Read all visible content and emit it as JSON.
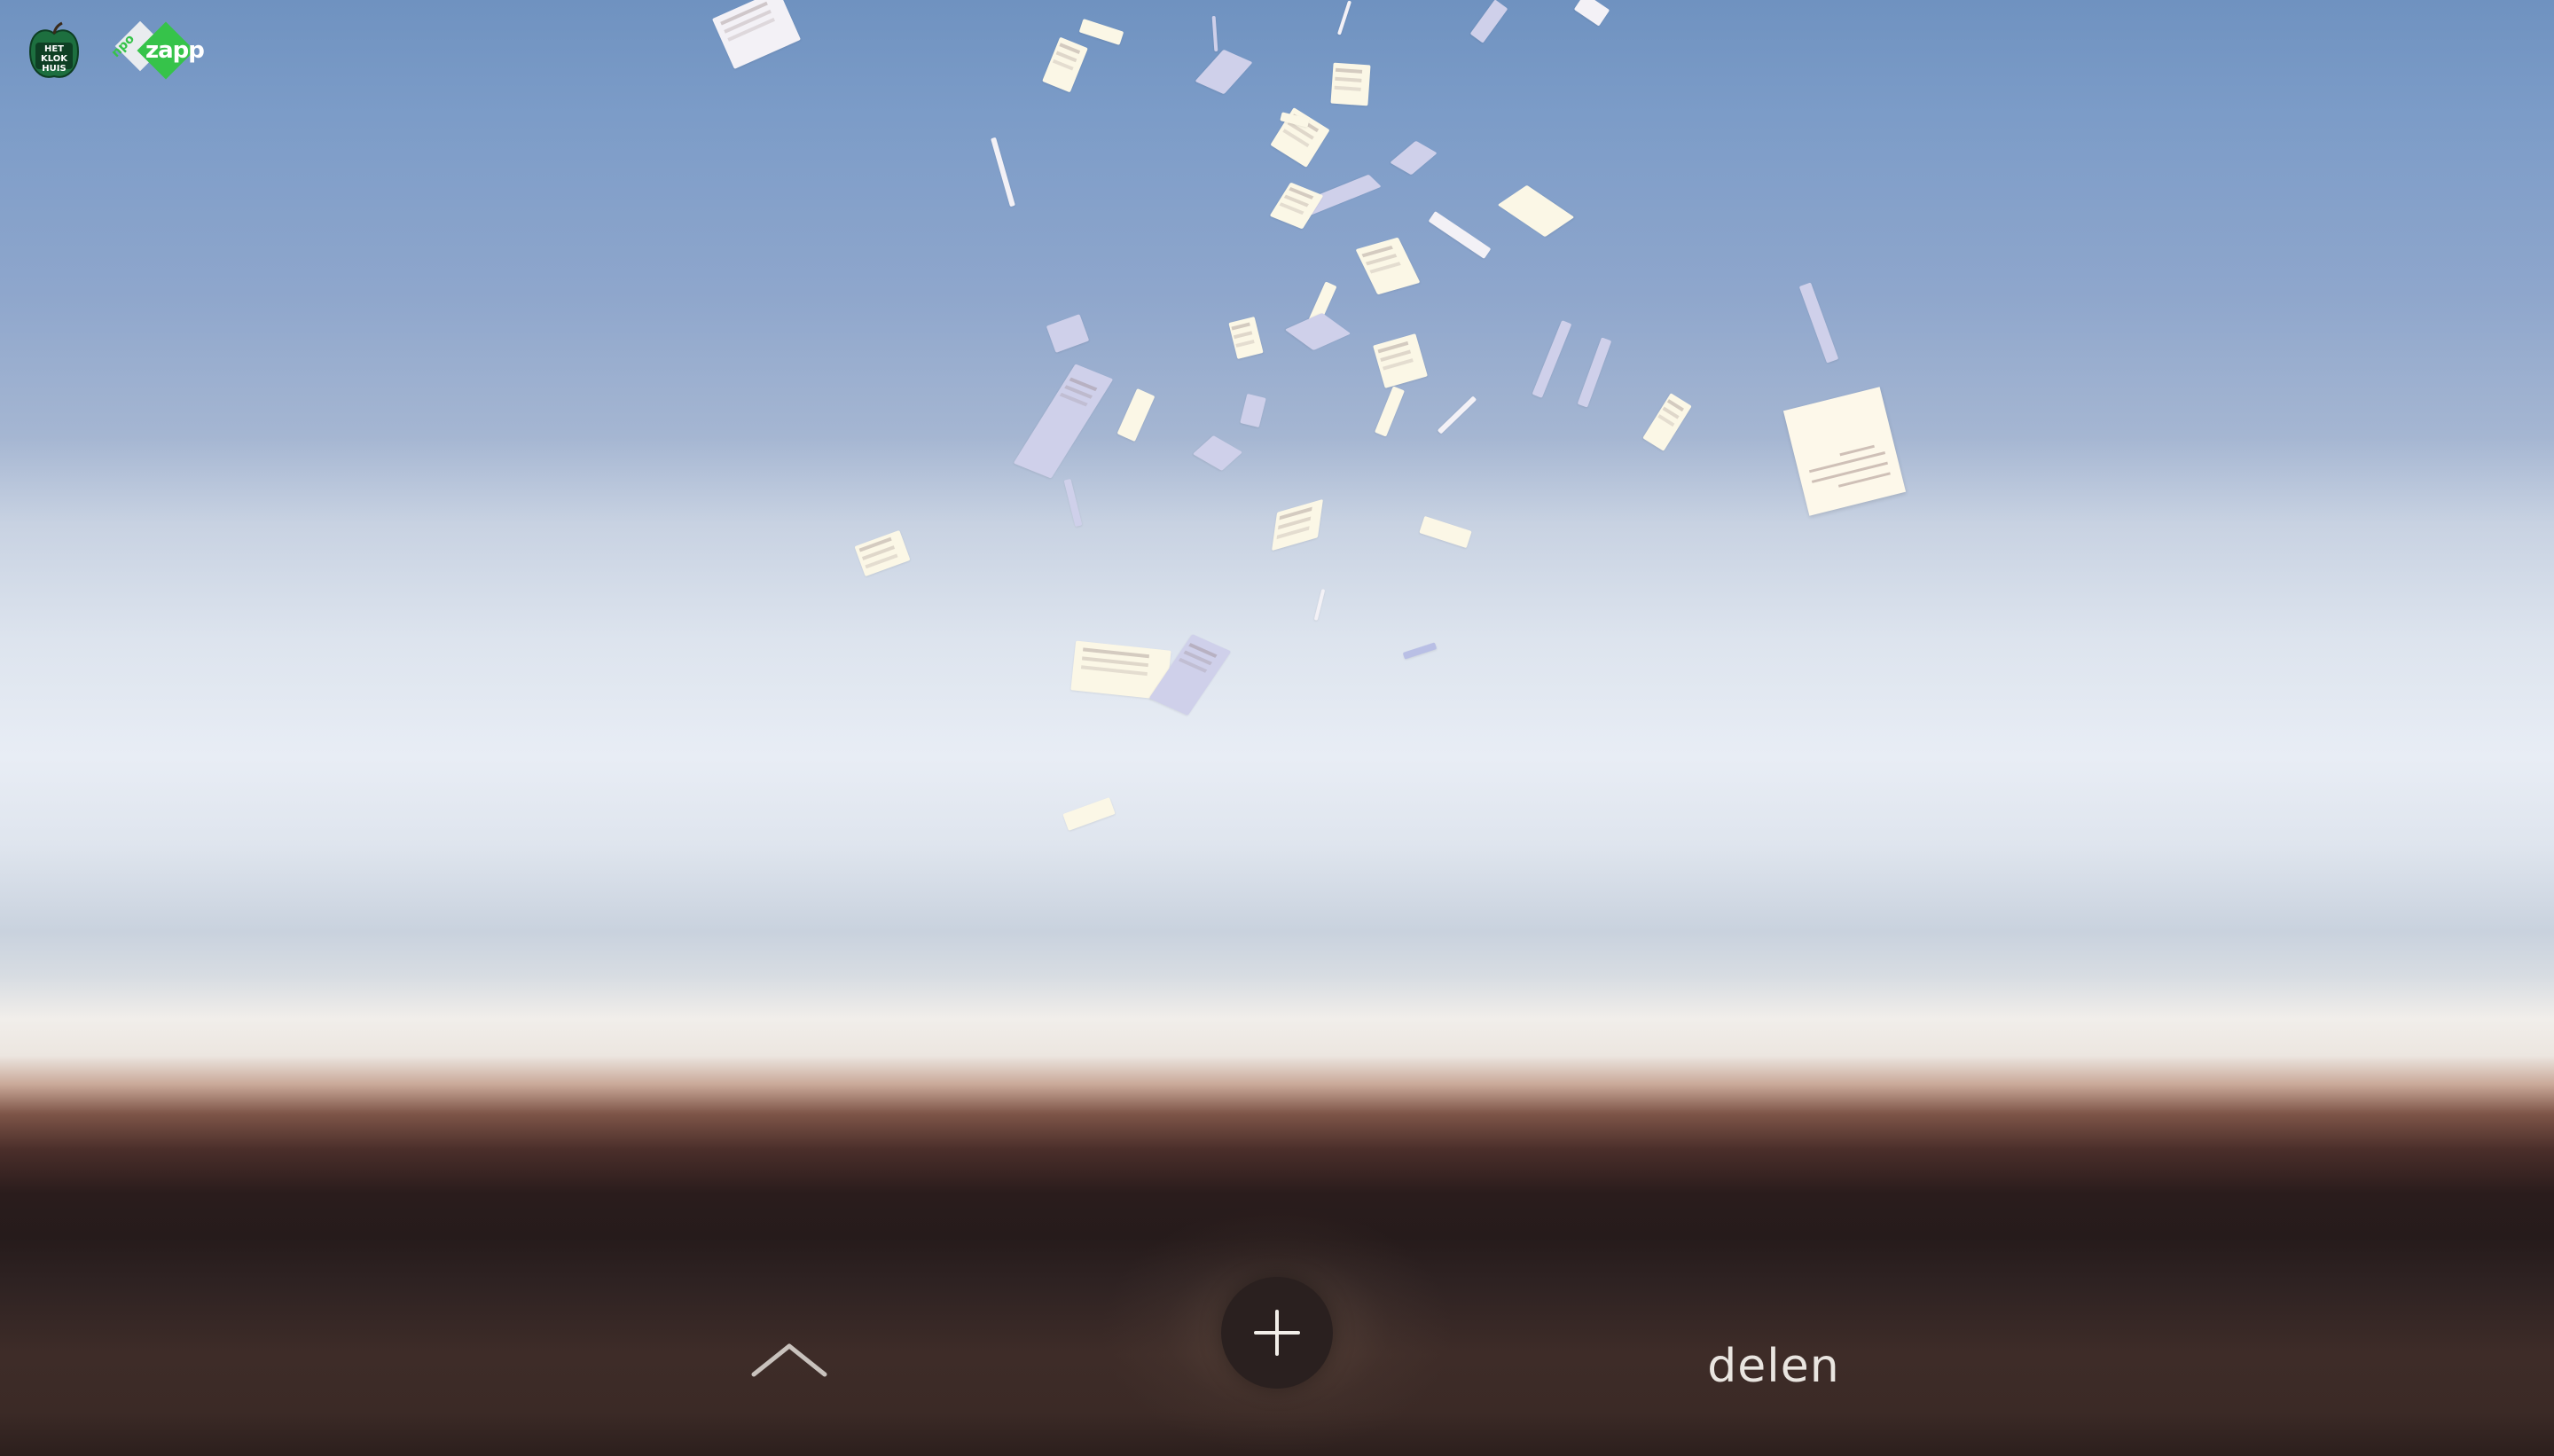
{
  "branding": {
    "logo_left_text": "HET KLOK HUIS",
    "logo_right_prefix": "npo",
    "logo_right_text": "zapp"
  },
  "toolbar": {
    "up_icon": "chevron-up-icon",
    "add_icon": "plus-icon",
    "share_label": "delen"
  },
  "colors": {
    "sky_top": "#6f92c0",
    "horizon": "#f1eeea",
    "ground": "#261b1b",
    "add_button_bg": "#2a201f",
    "share_text": "#e9e5e0",
    "zapp_green": "#36c34a"
  }
}
